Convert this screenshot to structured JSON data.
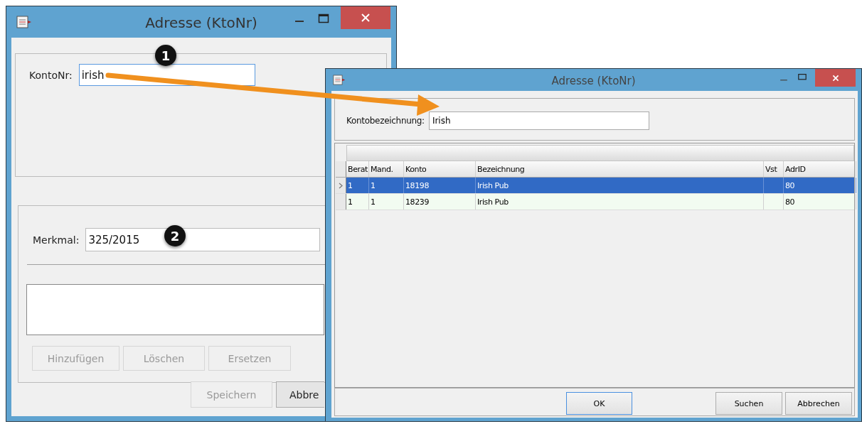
{
  "main_window": {
    "title": "Adresse (KtoNr)",
    "konto_label": "KontoNr:",
    "konto_value": "irish",
    "merkmal_label": "Merkmal:",
    "merkmal_value": "325/2015",
    "list_buttons": [
      {
        "label": "Hinzufügen",
        "disabled": true
      },
      {
        "label": "Löschen",
        "disabled": true
      },
      {
        "label": "Ersetzen",
        "disabled": true
      }
    ],
    "footer_buttons": [
      {
        "label": "Speichern",
        "disabled": true
      },
      {
        "label": "Abbre",
        "disabled": false
      }
    ]
  },
  "lookup_window": {
    "title": "Adresse (KtoNr)",
    "search_label": "Kontobezeichnung:",
    "search_value": "Irish",
    "table": {
      "columns": [
        "Berat",
        "Mand.",
        "Konto",
        "Bezeichnung",
        "Vst",
        "AdrID"
      ],
      "rows": [
        {
          "selected": true,
          "cells": [
            "1",
            "1",
            "18198",
            "Irish Pub",
            "",
            "80"
          ]
        },
        {
          "selected": false,
          "cells": [
            "1",
            "1",
            "18239",
            "Irish Pub",
            "",
            "80"
          ]
        }
      ]
    },
    "buttons": [
      "OK",
      "Suchen",
      "Abbrechen"
    ]
  },
  "annotations": [
    {
      "number": "1"
    },
    {
      "number": "2"
    }
  ]
}
